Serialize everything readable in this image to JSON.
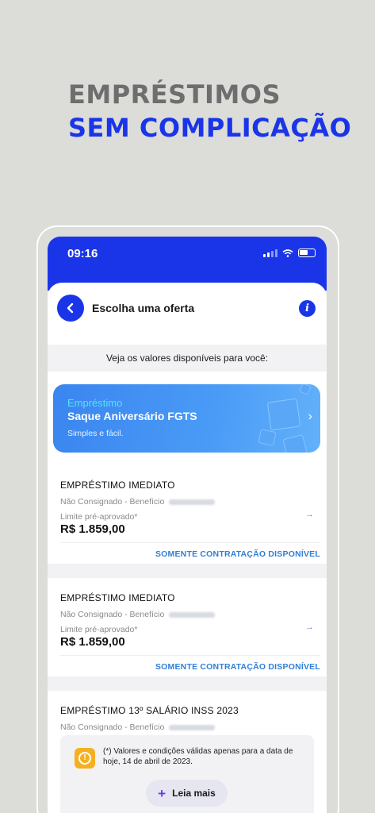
{
  "headline": {
    "line1": "EMPRÉSTIMOS",
    "line2": "SEM COMPLICAÇÃO"
  },
  "status_bar": {
    "time": "09:16"
  },
  "header": {
    "title": "Escolha uma oferta",
    "info_label": "i"
  },
  "subtitle": "Veja os valores disponíveis para você:",
  "promo": {
    "tag": "Empréstimo",
    "title": "Saque Aniversário FGTS",
    "description": "Simples e fácil.",
    "chevron": "›"
  },
  "offers": [
    {
      "title": "EMPRÉSTIMO IMEDIATO",
      "type": "Não Consignado - Benefício",
      "limit_label": "Limite pré-aprovado*",
      "value": "R$ 1.859,00",
      "link": "SOMENTE CONTRATAÇÃO DISPONÍVEL",
      "arrow": "→"
    },
    {
      "title": "EMPRÉSTIMO IMEDIATO",
      "type": "Não Consignado - Benefício",
      "limit_label": "Limite pré-aprovado*",
      "value": "R$ 1.859,00",
      "link": "SOMENTE CONTRATAÇÃO DISPONÍVEL",
      "arrow": "→"
    },
    {
      "title": "EMPRÉSTIMO 13º SALÁRIO INSS 2023",
      "type": "Não Consignado - Benefício"
    }
  ],
  "notice": {
    "text": "(*) Valores e condições válidas apenas para a data de hoje, 14 de abril de 2023.",
    "icon_glyph": "!",
    "read_more_icon": "+",
    "read_more": "Leia mais"
  },
  "colors": {
    "brand_blue": "#1a35e8",
    "link_blue": "#2f7fd6",
    "warning": "#f5b021",
    "headline_gray": "#6d6e6e"
  }
}
